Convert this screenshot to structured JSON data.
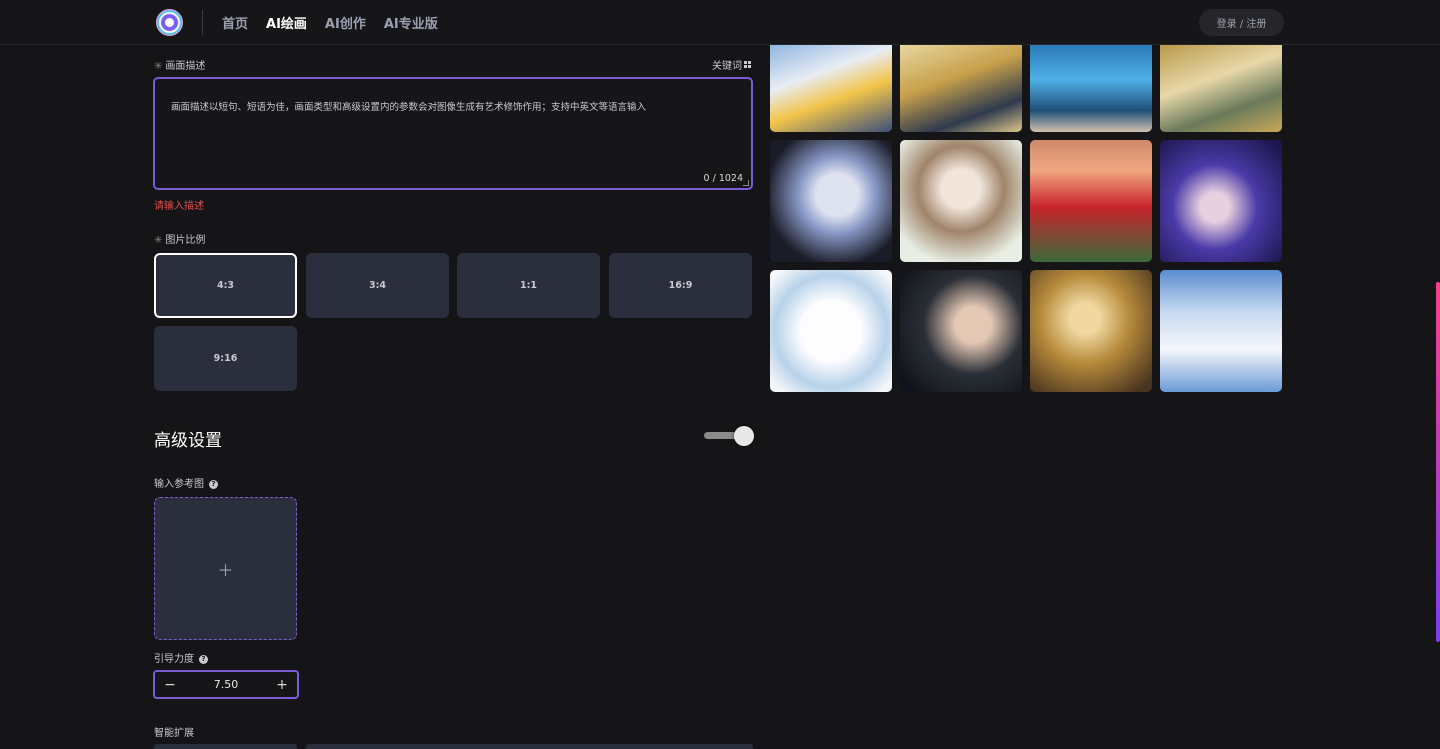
{
  "nav": {
    "items": [
      "首页",
      "AI绘画",
      "AI创作",
      "AI专业版"
    ],
    "active_index": 1
  },
  "header": {
    "login_label": "登录 / 注册"
  },
  "description": {
    "label": "画面描述",
    "keyword_label": "关键词",
    "placeholder": "画面描述以短句、短语为佳，画面类型和高级设置内的参数会对图像生成有艺术修饰作用；支持中英文等语言输入",
    "count": "0 / 1024",
    "error": "请输入描述"
  },
  "ratio": {
    "label": "图片比例",
    "options": [
      "4:3",
      "3:4",
      "1:1",
      "16:9",
      "9:16"
    ],
    "selected": "4:3"
  },
  "advanced": {
    "title": "高级设置",
    "toggle_on": true,
    "reference_label": "输入参考图",
    "guidance_label": "引导力度",
    "guidance_value": "7.50",
    "smart_expand_label": "智能扩展"
  },
  "colors": {
    "accent": "#7b5bd6",
    "error": "#e05050",
    "card": "#2b2f3d"
  },
  "gallery": [
    "anime-girl-yellow-coat",
    "anime-girls-gold-outfits",
    "blue-hair-figure",
    "golden-dress-girl",
    "silver-hair-girl-dark",
    "maid-girl-window",
    "red-tulips",
    "purple-hair-girl",
    "white-hair-boy",
    "dark-hair-woman",
    "long-brown-hair-girl",
    "white-dress-girl-clouds"
  ]
}
